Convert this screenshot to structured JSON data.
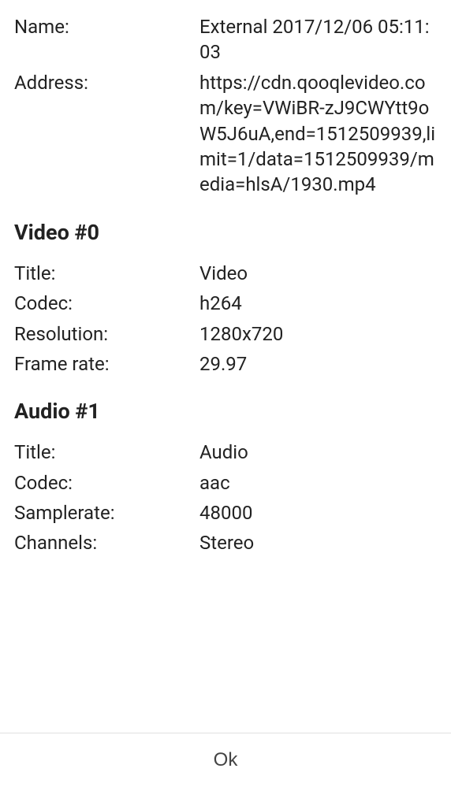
{
  "general": {
    "name_label": "Name:",
    "name_value": "External 2017/12/06 05:11:03",
    "address_label": "Address:",
    "address_value": "https://cdn.qooqlevideo.com/key=VWiBR-zJ9CWYtt9oW5J6uA,end=1512509939,limit=1/data=1512509939/media=hlsA/1930.mp4"
  },
  "video": {
    "section_title": "Video #0",
    "title_label": "Title:",
    "title_value": "Video",
    "codec_label": "Codec:",
    "codec_value": "h264",
    "resolution_label": "Resolution:",
    "resolution_value": "1280x720",
    "framerate_label": "Frame rate:",
    "framerate_value": "29.97"
  },
  "audio": {
    "section_title": "Audio #1",
    "title_label": "Title:",
    "title_value": "Audio",
    "codec_label": "Codec:",
    "codec_value": "aac",
    "samplerate_label": "Samplerate:",
    "samplerate_value": "48000",
    "channels_label": "Channels:",
    "channels_value": "Stereo"
  },
  "footer": {
    "ok_label": "Ok"
  }
}
